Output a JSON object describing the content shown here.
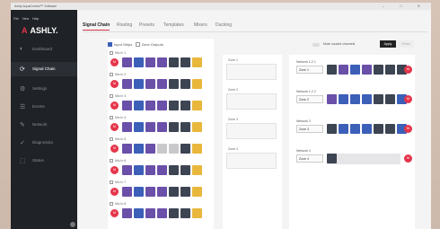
{
  "window": {
    "title": "Ashly AquaControl™ Software",
    "controls": "–  □  ✕"
  },
  "menubar": [
    "File",
    "View",
    "Help"
  ],
  "brand": {
    "logo_text": "ASHLY.",
    "logo_mark": "A"
  },
  "sidebar": {
    "items": [
      {
        "label": "Dashboard",
        "icon": "dashboard-icon",
        "glyph": "◐"
      },
      {
        "label": "Signal Chain",
        "icon": "signal-chain-icon",
        "glyph": "⟳",
        "active": true
      },
      {
        "label": "Settings",
        "icon": "settings-icon",
        "glyph": "⚙"
      },
      {
        "label": "Events",
        "icon": "events-icon",
        "glyph": "☰"
      },
      {
        "label": "Network",
        "icon": "network-icon",
        "glyph": "✎"
      },
      {
        "label": "Diagnostics",
        "icon": "diagnostics-icon",
        "glyph": "✓"
      },
      {
        "label": "Status",
        "icon": "status-icon",
        "glyph": "⬚"
      }
    ]
  },
  "tabs": [
    "Signal Chain",
    "Routing",
    "Presets",
    "Templates",
    "Mixers",
    "Ducking"
  ],
  "legend": {
    "input": "Input Strips",
    "output": "Zone Outputs"
  },
  "toolbar": {
    "toggle_label": "Mute unused channels",
    "apply": "Apply",
    "reset": "Reset"
  },
  "rows": [
    {
      "label": "Mic In 1"
    },
    {
      "label": "Mic In 2"
    },
    {
      "label": "Mic In 3"
    },
    {
      "label": "Mic In 4"
    },
    {
      "label": "Mic In 5"
    },
    {
      "label": "Mic In 6"
    },
    {
      "label": "Mic In 7"
    },
    {
      "label": "Mic In 8"
    }
  ],
  "mute_text": "M",
  "mid": {
    "slots": [
      "Zone 1",
      "Zone 2",
      "Zone 3",
      "Zone 4"
    ]
  },
  "right": {
    "groups": [
      {
        "title": "Network 1-2  1",
        "select": "Zone 1"
      },
      {
        "title": "Network 1-2  2",
        "select": "Zone 2"
      },
      {
        "title": "Network 3",
        "select": "Zone 3"
      },
      {
        "title": "Network 4",
        "select": "Zone 4"
      }
    ]
  },
  "colors": {
    "accent": "#e5354a",
    "purple": "#6a50a8",
    "blue": "#3c5fb8",
    "dark": "#3d4452",
    "yellow": "#e8b73c",
    "sidebar": "#1f2226"
  }
}
